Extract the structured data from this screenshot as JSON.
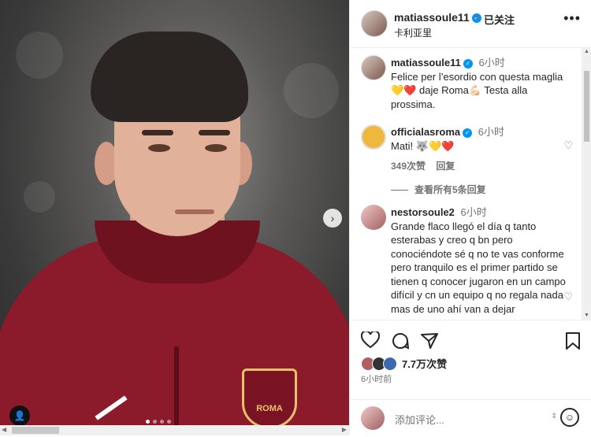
{
  "post": {
    "author": "matiassoule11",
    "follow_label": "已关注",
    "location": "卡利亚里",
    "more_label": "•••",
    "crest_text": "ROMA",
    "likes": "7.7万次赞",
    "time": "6小时前",
    "comment_placeholder": "添加评论..."
  },
  "comments": [
    {
      "user": "matiassoule11",
      "time": "6小时",
      "text": "Felice per l’esordio con questa maglia💛❤️ daje Roma💪🏻 Testa alla prossima."
    },
    {
      "user": "officialasroma",
      "time": "6小时",
      "text": "Mati! 🐺💛❤️",
      "likes": "349次赞",
      "reply": "回复",
      "view_replies": "查看所有5条回复"
    },
    {
      "user": "nestorsoule2",
      "time": "6小时",
      "text": "Grande flaco llegó el día q tanto esterabas y creo q bn pero conociéndote sé q no te vas conforme pero tranquilo es el primer partido se tienen q conocer jugaron en un campo difícil y cn un equipo q no regala nada mas de uno ahí van a dejar"
    }
  ]
}
